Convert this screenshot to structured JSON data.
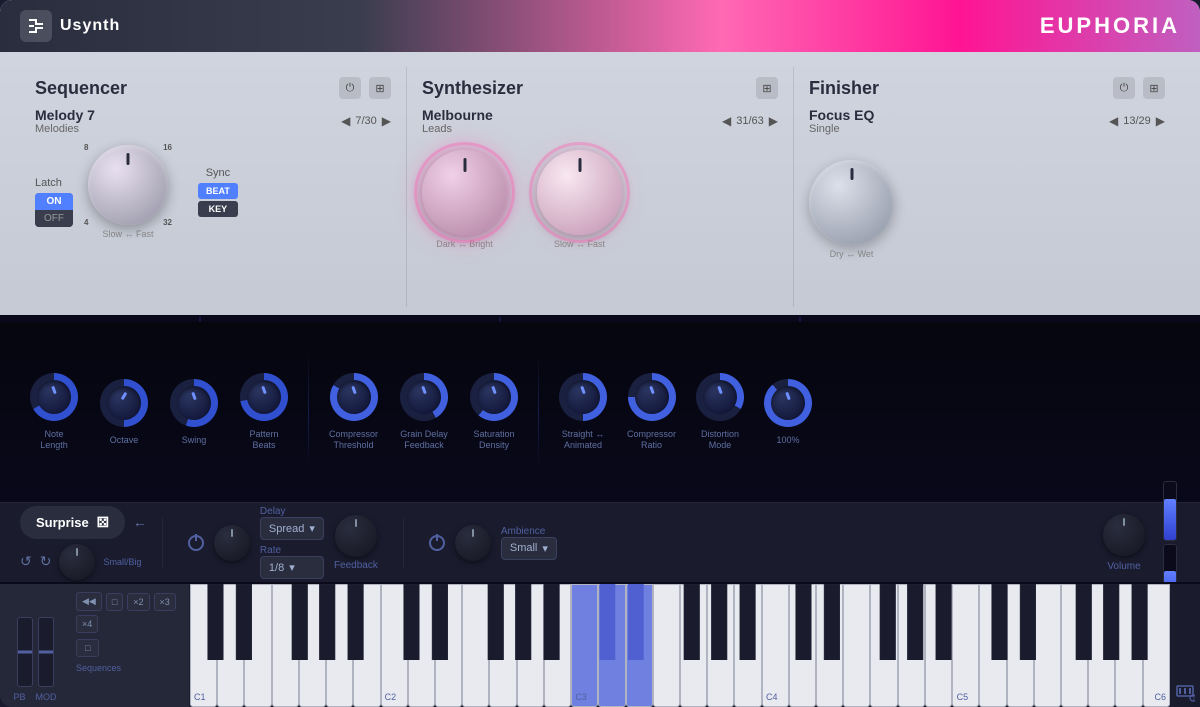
{
  "app": {
    "logo": "Usynth",
    "brand": "EUPHORIA"
  },
  "sequencer": {
    "title": "Sequencer",
    "preset_name": "Melody 7",
    "preset_sub": "Melodies",
    "preset_count": "7/30",
    "latch_label": "Latch",
    "latch_on": "ON",
    "latch_off": "OFF",
    "sync_label": "Sync",
    "sync_beat": "BEAT",
    "sync_key": "KEY",
    "knob_label": "Slow ↔ Fast",
    "knob_nums": {
      "tl": "8",
      "tr": "16",
      "bl": "4",
      "br": "32"
    }
  },
  "synthesizer": {
    "title": "Synthesizer",
    "preset_name": "Melbourne",
    "preset_sub": "Leads",
    "preset_count": "31/63",
    "knob1_label": "Dark ↔ Bright",
    "knob2_label": "Slow ↔ Fast"
  },
  "finisher": {
    "title": "Finisher",
    "preset_name": "Focus EQ",
    "preset_sub": "Single",
    "preset_count": "13/29",
    "knob_label": "Dry ↔ Wet"
  },
  "middle": {
    "knobs": [
      {
        "id": "note-length",
        "label": "Note\nLength"
      },
      {
        "id": "octave",
        "label": "Octave"
      },
      {
        "id": "swing",
        "label": "Swing"
      },
      {
        "id": "pattern-beats",
        "label": "Pattern\nBeats"
      },
      {
        "id": "compressor-threshold",
        "label": "Compressor\nThreshold"
      },
      {
        "id": "grain-delay-feedback",
        "label": "Grain Delay\nFeedback"
      },
      {
        "id": "saturation-density",
        "label": "Saturation\nDensity"
      },
      {
        "id": "straight-animated",
        "label": "Straight ↔\nAnimated"
      },
      {
        "id": "compressor-ratio",
        "label": "Compressor\nRatio"
      },
      {
        "id": "distortion-mode",
        "label": "Distortion\nMode"
      }
    ],
    "volume_label": "100%"
  },
  "bottom_controls": {
    "surprise_label": "Surprise",
    "small_big_label": "Small/Big",
    "delay_label": "Delay",
    "delay_value": "Spread",
    "rate_label": "Rate",
    "rate_value": "1/8",
    "feedback_label": "Feedback",
    "ambience_label": "Ambience",
    "ambience_value": "Small",
    "volume_label": "Volume"
  },
  "keyboard": {
    "pb_label": "PB",
    "mod_label": "MOD",
    "c1_label": "C1",
    "c2_label": "C2",
    "c3_label": "C3",
    "c4_label": "C4",
    "c5_label": "C5",
    "c6_label": "C6",
    "sequences_label": "Sequences",
    "seq_buttons": [
      "◀◀",
      "□",
      "×2",
      "×3",
      "×4",
      "□"
    ]
  },
  "colors": {
    "accent_blue": "#4060e0",
    "accent_pink": "#ff69b4",
    "bg_dark": "#08081a",
    "bg_light": "#c8cdd8",
    "knob_glow": "rgba(60,80,255,0.4)"
  }
}
